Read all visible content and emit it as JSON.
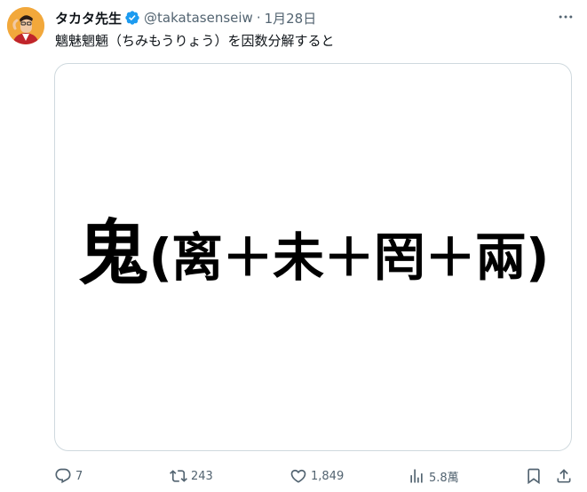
{
  "tweet": {
    "display_name": "タカタ先生",
    "handle": "@takatasenseiw",
    "separator": "·",
    "date": "1月28日",
    "text": "魑魅魍魎（ちみもうりょう）を因数分解すると"
  },
  "media": {
    "formula_main": "鬼",
    "formula_parts": "(离＋未＋罔＋兩)"
  },
  "actions": {
    "replies": "7",
    "reposts": "243",
    "likes": "1,849",
    "views": "5.8萬"
  },
  "colors": {
    "text": "#0f1419",
    "muted": "#536471",
    "verified": "#1d9bf0",
    "border": "#cfd9de"
  },
  "icons": [
    "avatar",
    "verified-badge-icon",
    "more-icon",
    "reply-icon",
    "repost-icon",
    "like-icon",
    "views-icon",
    "bookmark-icon",
    "share-icon"
  ]
}
